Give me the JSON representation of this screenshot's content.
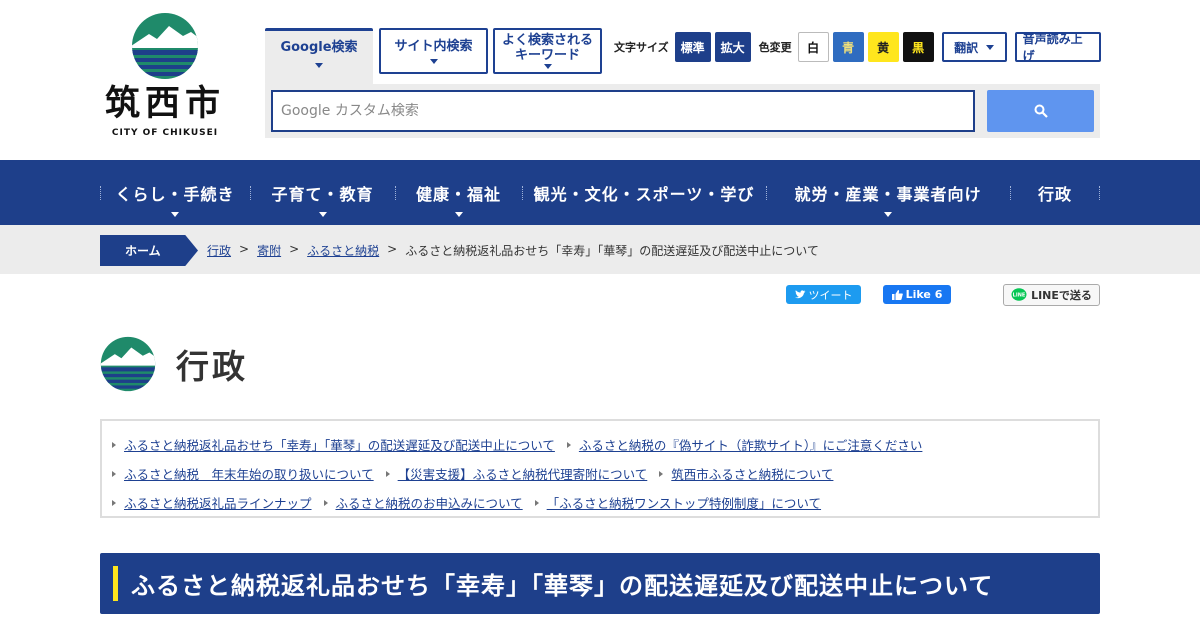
{
  "logo": {
    "city_name": "筑西市",
    "city_en": "CITY OF CHIKUSEI",
    "colors": {
      "green": "#1f8a6a",
      "navy": "#1e3f8a"
    }
  },
  "search_tabs": [
    {
      "label": "Google検索",
      "active": true
    },
    {
      "label": "サイト内検索",
      "active": false
    },
    {
      "label": "よく検索される\nキーワード",
      "active": false
    }
  ],
  "tools": {
    "font_size_label": "文字サイズ",
    "font_size_options": [
      "標準",
      "拡大"
    ],
    "color_label": "色変更",
    "color_options": [
      "白",
      "青",
      "黄",
      "黒"
    ],
    "translate_label": "翻訳",
    "read_aloud_label": "音声読み上げ"
  },
  "search": {
    "placeholder": "Google カスタム検索",
    "button_icon": "search-icon"
  },
  "gnav": [
    {
      "label": "くらし・手続き",
      "dropdown": true
    },
    {
      "label": "子育て・教育",
      "dropdown": true
    },
    {
      "label": "健康・福祉",
      "dropdown": true
    },
    {
      "label": "観光・文化・スポーツ・学び",
      "dropdown": false
    },
    {
      "label": "就労・産業・事業者向け",
      "dropdown": true
    },
    {
      "label": "行政",
      "dropdown": false
    }
  ],
  "breadcrumb": {
    "home": "ホーム",
    "items": [
      "行政",
      "寄附",
      "ふるさと納税"
    ],
    "separator": ">",
    "current": "ふるさと納税返礼品おせち「幸寿」「華琴」の配送遅延及び配送中止について"
  },
  "share": {
    "tweet": "ツイート",
    "like": "Like 6",
    "line": "LINEで送る"
  },
  "section": {
    "title": "行政"
  },
  "related_links": [
    [
      "ふるさと納税返礼品おせち「幸寿」「華琴」の配送遅延及び配送中止について",
      "ふるさと納税の『偽サイト（詐欺サイト）』にご注意ください"
    ],
    [
      "ふるさと納税　年末年始の取り扱いについて",
      "【災害支援】ふるさと納税代理寄附について",
      "筑西市ふるさと納税について"
    ],
    [
      "ふるさと納税返礼品ラインナップ",
      "ふるさと納税のお申込みについて",
      "「ふるさと納税ワンストップ特例制度」について"
    ]
  ],
  "page_title": "ふるさと納税返礼品おせち「幸寿」「華琴」の配送遅延及び配送中止について",
  "colors": {
    "navy": "#1e3f8a",
    "accent_yellow": "#ffe61d",
    "search_blue": "#5f95ef"
  }
}
